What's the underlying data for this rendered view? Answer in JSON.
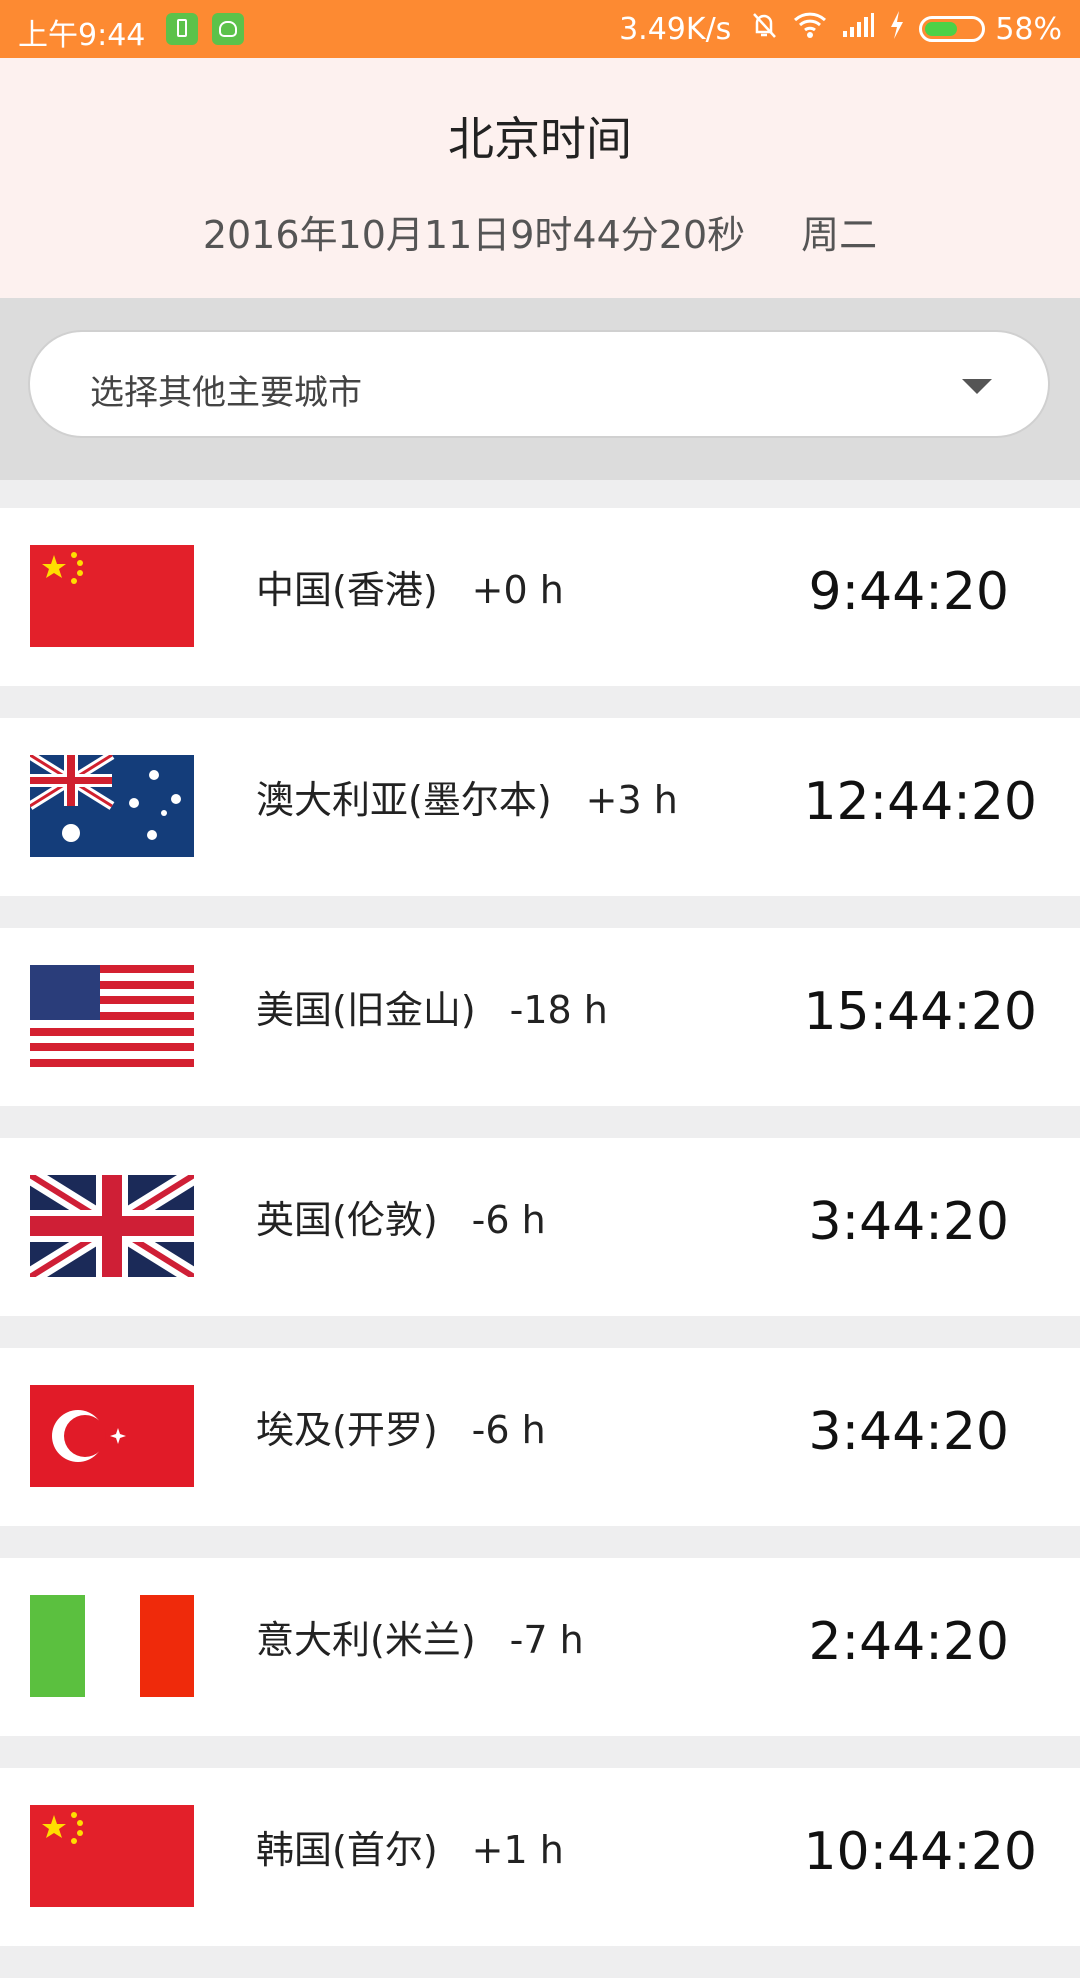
{
  "status_bar": {
    "time": "上午9:44",
    "net_speed": "3.49K/s",
    "battery_percent": "58%",
    "battery_level": 0.58,
    "icons": [
      "battery-app-icon",
      "android-app-icon",
      "mute-bell-icon",
      "wifi-icon",
      "signal-icon",
      "charging-icon"
    ]
  },
  "header": {
    "title": "北京时间",
    "date": "2016年10月11日9时44分20秒",
    "weekday": "周二"
  },
  "city_select": {
    "label": "选择其他主要城市"
  },
  "cities": [
    {
      "flag": "china-flag-icon",
      "name": "中国(香港)",
      "offset": "+0 h",
      "time": "9:44:20"
    },
    {
      "flag": "australia-flag-icon",
      "name": "澳大利亚(墨尔本)",
      "offset": "+3 h",
      "time": "12:44:20"
    },
    {
      "flag": "usa-flag-icon",
      "name": "美国(旧金山)",
      "offset": "-18 h",
      "time": "15:44:20"
    },
    {
      "flag": "uk-flag-icon",
      "name": "英国(伦敦)",
      "offset": "-6 h",
      "time": "3:44:20"
    },
    {
      "flag": "turkey-flag-icon",
      "name": "埃及(开罗)",
      "offset": "-6 h",
      "time": "3:44:20"
    },
    {
      "flag": "italy-flag-icon",
      "name": "意大利(米兰)",
      "offset": "-7 h",
      "time": "2:44:20"
    },
    {
      "flag": "china-flag-icon",
      "name": "韩国(首尔)",
      "offset": "+1 h",
      "time": "10:44:20"
    }
  ],
  "colors": {
    "status_bar": "#fd8a32",
    "header_bg": "#fdf1ef",
    "select_bg": "#dcdcdc"
  }
}
